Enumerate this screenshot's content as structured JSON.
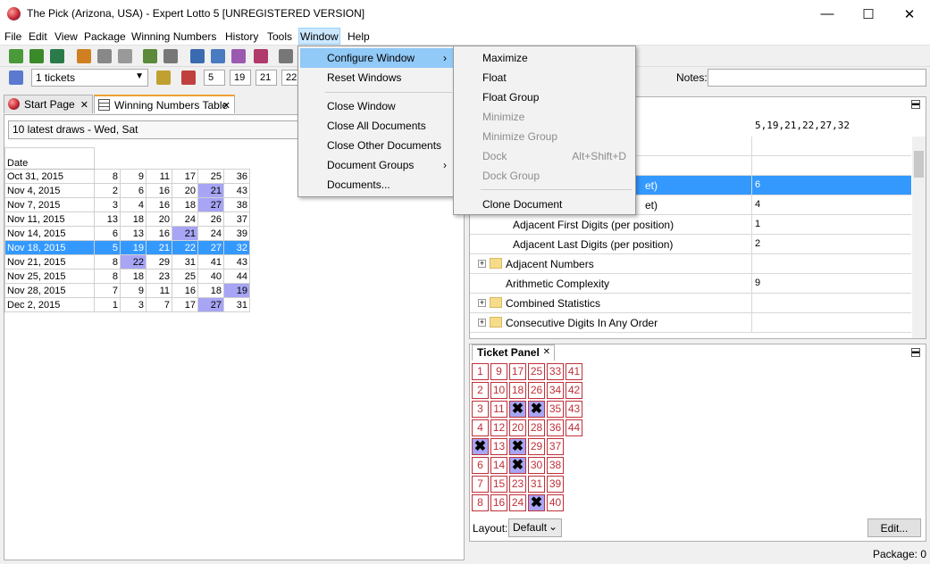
{
  "window": {
    "title": "The Pick (Arizona, USA) - Expert Lotto 5 [UNREGISTERED VERSION]",
    "min": "—",
    "max": "☐",
    "close": "✕"
  },
  "menu": [
    "File",
    "Edit",
    "View",
    "Package",
    "Winning Numbers",
    "History",
    "Tools",
    "Window",
    "Help"
  ],
  "toolbar": {
    "tickets_combo": "1 tickets",
    "numbers": [
      "5",
      "19",
      "21",
      "22"
    ],
    "notes_label": "Notes:"
  },
  "tabs": [
    {
      "label": "Start Page",
      "close": "✕"
    },
    {
      "label": "Winning Numbers Table",
      "close": "✕"
    }
  ],
  "draws_combo": "10 latest draws - Wed, Sat",
  "table": {
    "date_header": "Date",
    "rows": [
      {
        "date": "Oct 31, 2015",
        "n": [
          "8",
          "9",
          "11",
          "17",
          "25",
          "36"
        ],
        "hi": []
      },
      {
        "date": "Nov 4, 2015",
        "n": [
          "2",
          "6",
          "16",
          "20",
          "21",
          "43"
        ],
        "hi": [
          4
        ]
      },
      {
        "date": "Nov 7, 2015",
        "n": [
          "3",
          "4",
          "16",
          "18",
          "27",
          "38"
        ],
        "hi": [
          4
        ]
      },
      {
        "date": "Nov 11, 2015",
        "n": [
          "13",
          "18",
          "20",
          "24",
          "26",
          "37"
        ],
        "hi": []
      },
      {
        "date": "Nov 14, 2015",
        "n": [
          "6",
          "13",
          "16",
          "21",
          "24",
          "39"
        ],
        "hi": [
          3
        ]
      },
      {
        "date": "Nov 18, 2015",
        "n": [
          "5",
          "19",
          "21",
          "22",
          "27",
          "32"
        ],
        "hi": [],
        "sel": true
      },
      {
        "date": "Nov 21, 2015",
        "n": [
          "8",
          "22",
          "29",
          "31",
          "41",
          "43"
        ],
        "hi": [
          1
        ]
      },
      {
        "date": "Nov 25, 2015",
        "n": [
          "8",
          "18",
          "23",
          "25",
          "40",
          "44"
        ],
        "hi": []
      },
      {
        "date": "Nov 28, 2015",
        "n": [
          "7",
          "9",
          "11",
          "16",
          "18",
          "19"
        ],
        "hi": [
          5
        ]
      },
      {
        "date": "Dec 2, 2015",
        "n": [
          "1",
          "3",
          "7",
          "17",
          "27",
          "31"
        ],
        "hi": [
          4
        ]
      }
    ]
  },
  "properties": {
    "top_value": "5,19,21,22,27,32",
    "rows": [
      {
        "name": "",
        "val": "",
        "kind": "plain"
      },
      {
        "name": "",
        "val": "",
        "kind": "plain"
      },
      {
        "name": "et)",
        "val": "6",
        "kind": "sel"
      },
      {
        "name": "et)",
        "val": "4",
        "kind": "plain"
      },
      {
        "name": "Adjacent First Digits (per position)",
        "val": "1",
        "kind": "sub"
      },
      {
        "name": "Adjacent Last Digits (per position)",
        "val": "2",
        "kind": "sub"
      },
      {
        "name": "Adjacent Numbers",
        "val": "",
        "kind": "folder"
      },
      {
        "name": "Arithmetic Complexity",
        "val": "9",
        "kind": "item"
      },
      {
        "name": "Combined Statistics",
        "val": "",
        "kind": "folder"
      },
      {
        "name": "Consecutive Digits In Any Order",
        "val": "",
        "kind": "folder"
      }
    ]
  },
  "ticket_panel": {
    "title": "Ticket Panel",
    "close": "✕",
    "layout_label": "Layout:",
    "layout_value": "Default",
    "edit_button": "Edit...",
    "columns": [
      [
        "1",
        "2",
        "3",
        "4",
        "✖",
        "6",
        "7",
        "8"
      ],
      [
        "9",
        "10",
        "11",
        "12",
        "13",
        "14",
        "15",
        "16"
      ],
      [
        "17",
        "18",
        "✖",
        "20",
        "✖",
        "✖",
        "23",
        "24"
      ],
      [
        "25",
        "26",
        "✖",
        "28",
        "29",
        "30",
        "31",
        "✖"
      ],
      [
        "33",
        "34",
        "35",
        "36",
        "37",
        "38",
        "39",
        "40"
      ],
      [
        "41",
        "42",
        "43",
        "44",
        "",
        "",
        "",
        ""
      ]
    ]
  },
  "window_menu": {
    "items": [
      "Configure Window",
      "Reset Windows",
      "Close Window",
      "Close All Documents",
      "Close Other Documents",
      "Document Groups",
      "Documents..."
    ]
  },
  "configure_submenu": {
    "items": [
      "Maximize",
      "Float",
      "Float Group",
      "Minimize",
      "Minimize Group",
      "Dock",
      "Dock Group",
      "Clone Document"
    ],
    "dock_shortcut": "Alt+Shift+D"
  },
  "status": {
    "package": "Package: 0"
  }
}
